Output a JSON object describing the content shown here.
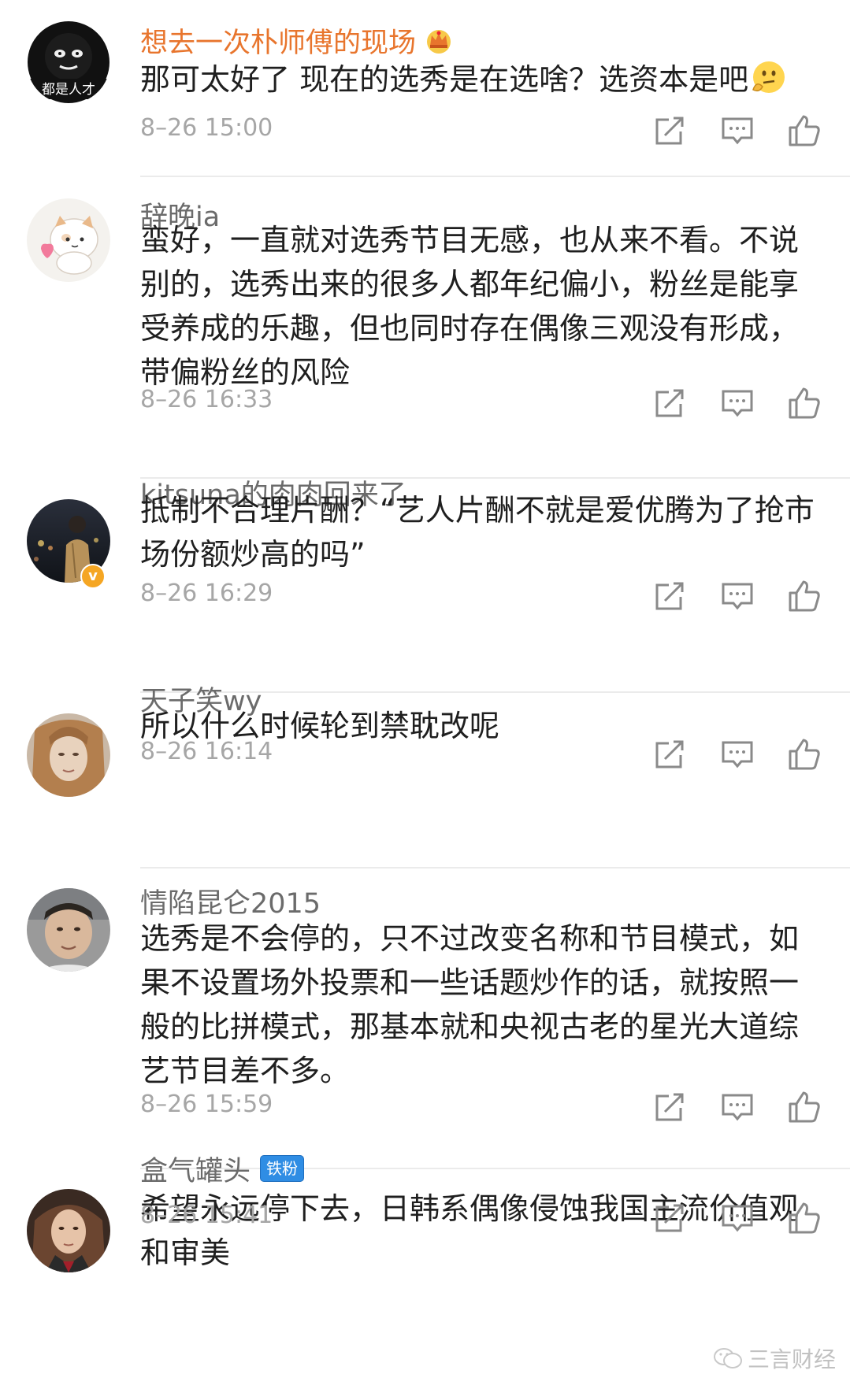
{
  "comments": [
    {
      "username": "想去一次朴师傅的现场",
      "avatar_text": "都是人才",
      "text": "那可太好了 现在的选秀是在选啥？选资本是吧",
      "time": "8–26 15:00"
    },
    {
      "username": "辞晚ia",
      "text": "蛮好，一直就对选秀节目无感，也从来不看。不说别的，选秀出来的很多人都年纪偏小，粉丝是能享受养成的乐趣，但也同时存在偶像三观没有形成，带偏粉丝的风险",
      "time": "8–26 16:33"
    },
    {
      "username": "kitsuna的肉肉回来了",
      "text": "抵制不合理片酬？“艺人片酬不就是爱优腾为了抢市场份额炒高的吗”",
      "time": "8–26 16:29"
    },
    {
      "username": "天子笑wy",
      "text": "所以什么时候轮到禁耽改呢",
      "time": "8–26 16:14"
    },
    {
      "username": "情陷昆仑2015",
      "text": "选秀是不会停的，只不过改变名称和节目模式，如果不设置场外投票和一些话题炒作的话，就按照一般的比拼模式，那基本就和央视古老的星光大道综艺节目差不多。",
      "time": "8–26 15:59"
    },
    {
      "username": "盒气罐头",
      "badge": "铁粉",
      "text": "希望永远停下去，日韩系偶像侵蚀我国主流价值观和审美",
      "time": "8–26 15:41"
    }
  ],
  "watermark": "三言财经",
  "icons": {
    "repost": "repost-icon",
    "comment": "comment-icon",
    "like": "thumbs-up-icon"
  },
  "colors": {
    "vip_name": "#e8752d",
    "name": "#6b6b6b",
    "text": "#1f1f1f",
    "time": "#a6a6a6",
    "fan_badge": "#2f8de4"
  }
}
